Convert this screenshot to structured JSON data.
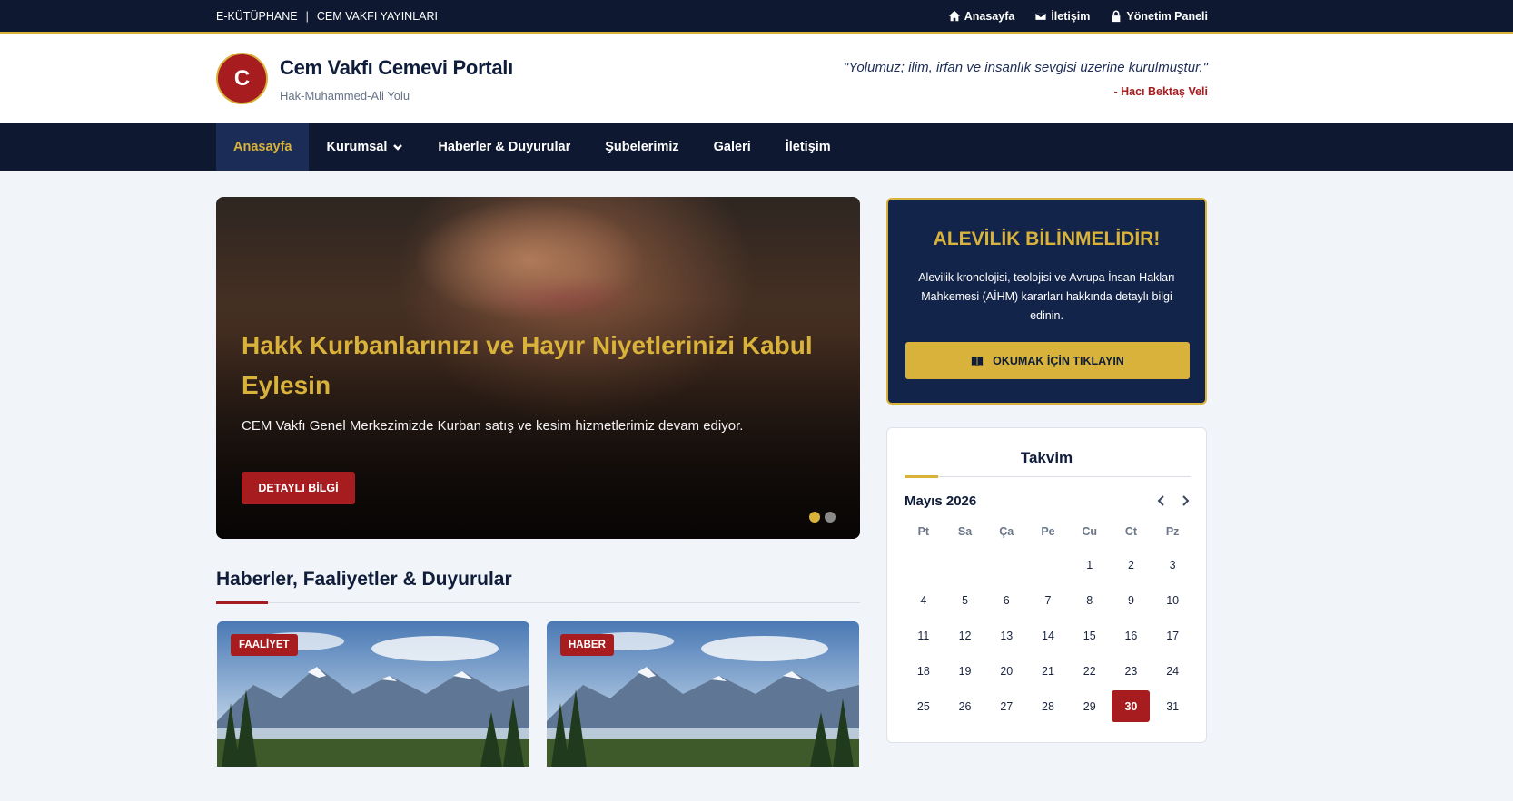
{
  "topbar": {
    "left": [
      "E-KÜTÜPHANE",
      "CEM VAKFI YAYINLARI"
    ],
    "separator": "|",
    "links": [
      {
        "label": "Anasayfa",
        "icon": "home-icon"
      },
      {
        "label": "İletişim",
        "icon": "envelope-icon"
      },
      {
        "label": "Yönetim Paneli",
        "icon": "lock-icon"
      }
    ]
  },
  "header": {
    "logo_letter": "C",
    "title": "Cem Vakfı Cemevi Portalı",
    "subtitle": "Hak-Muhammed-Ali Yolu",
    "quote": "\"Yolumuz; ilim, irfan ve insanlık sevgisi üzerine kurulmuştur.\"",
    "quote_author": "- Hacı Bektaş Veli"
  },
  "nav": {
    "items": [
      "Anasayfa",
      "Kurumsal",
      "Haberler & Duyurular",
      "Şubelerimiz",
      "Galeri",
      "İletişim"
    ],
    "active": "Anasayfa"
  },
  "slider": {
    "title": "Hakk Kurbanlarınızı ve Hayır Niyetlerinizi Kabul Eylesin",
    "description": "CEM Vakfı Genel Merkezimizde Kurban satış ve kesim hizmetlerimiz devam ediyor.",
    "button": "DETAYLI BİLGİ",
    "slides_total": 2,
    "active_slide": 1
  },
  "news": {
    "title": "Haberler, Faaliyetler & Duyurular",
    "cards": [
      {
        "badge": "FAALİYET"
      },
      {
        "badge": "HABER"
      }
    ]
  },
  "promo": {
    "title": "ALEVİLİK BİLİNMELİDİR!",
    "text": "Alevilik kronolojisi, teolojisi ve Avrupa İnsan Hakları Mahkemesi (AİHM) kararları hakkında detaylı bilgi edinin.",
    "button": "OKUMAK İÇİN TIKLAYIN",
    "button_icon": "book-icon"
  },
  "calendar": {
    "title": "Takvim",
    "month": "Mayıs 2026",
    "weekdays": [
      "Pt",
      "Sa",
      "Ça",
      "Pe",
      "Cu",
      "Ct",
      "Pz"
    ],
    "weeks": [
      [
        "",
        "",
        "",
        "",
        "1",
        "2",
        "3"
      ],
      [
        "4",
        "5",
        "6",
        "7",
        "8",
        "9",
        "10"
      ],
      [
        "11",
        "12",
        "13",
        "14",
        "15",
        "16",
        "17"
      ],
      [
        "18",
        "19",
        "20",
        "21",
        "22",
        "23",
        "24"
      ],
      [
        "25",
        "26",
        "27",
        "28",
        "29",
        "30",
        "31"
      ]
    ],
    "today": "30"
  },
  "colors": {
    "navy": "#0e1830",
    "gold": "#d8b23a",
    "red": "#a71c1f"
  }
}
